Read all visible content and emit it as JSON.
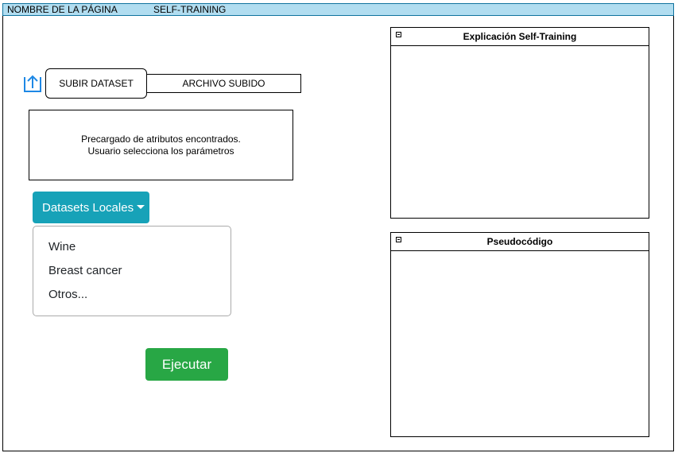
{
  "header": {
    "page_name": "NOMBRE DE LA PÁGINA",
    "section": "SELF-TRAINING"
  },
  "upload": {
    "button_label": "SUBIR DATASET",
    "file_label": "ARCHIVO SUBIDO",
    "icon": "upload-icon"
  },
  "params": {
    "line1": "Precargado de atributos encontrados.",
    "line2": "Usuario selecciona los parámetros"
  },
  "datasets": {
    "button_label": "Datasets Locales",
    "items": [
      "Wine",
      "Breast cancer",
      "Otros..."
    ]
  },
  "run": {
    "label": "Ejecutar"
  },
  "panels": {
    "explanation_title": "Explicación Self-Training",
    "pseudocode_title": "Pseudocódigo"
  },
  "colors": {
    "topbar": "#b1ddf0",
    "dropdown": "#17a2b8",
    "run": "#28a745",
    "icon": "#1e88e5"
  }
}
